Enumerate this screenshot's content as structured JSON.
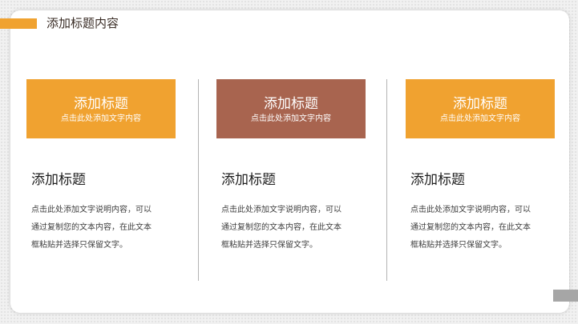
{
  "header": {
    "title": "添加标题内容"
  },
  "columns": [
    {
      "banner_title": "添加标题",
      "banner_subtitle": "点击此处添加文字内容",
      "banner_color": "#f0a230",
      "heading": "添加标题",
      "body_lines": [
        "点击此处添加文字说明内容，可以",
        "通过复制您的文本内容，在此文本",
        "框粘贴并选择只保留文字。"
      ]
    },
    {
      "banner_title": "添加标题",
      "banner_subtitle": "点击此处添加文字内容",
      "banner_color": "#a8644f",
      "heading": "添加标题",
      "body_lines": [
        "点击此处添加文字说明内容，可以",
        "通过复制您的文本内容，在此文本",
        "框粘贴并选择只保留文字。"
      ]
    },
    {
      "banner_title": "添加标题",
      "banner_subtitle": "点击此处添加文字内容",
      "banner_color": "#f0a230",
      "heading": "添加标题",
      "body_lines": [
        "点击此处添加文字说明内容，可以",
        "通过复制您的文本内容，在此文本",
        "框粘贴并选择只保留文字。"
      ]
    }
  ],
  "colors": {
    "accent_orange": "#f0a230",
    "accent_brown": "#a8644f",
    "title_text": "#3a2d26",
    "divider": "#b3b3b3",
    "corner_tab": "#a6a6a6"
  }
}
